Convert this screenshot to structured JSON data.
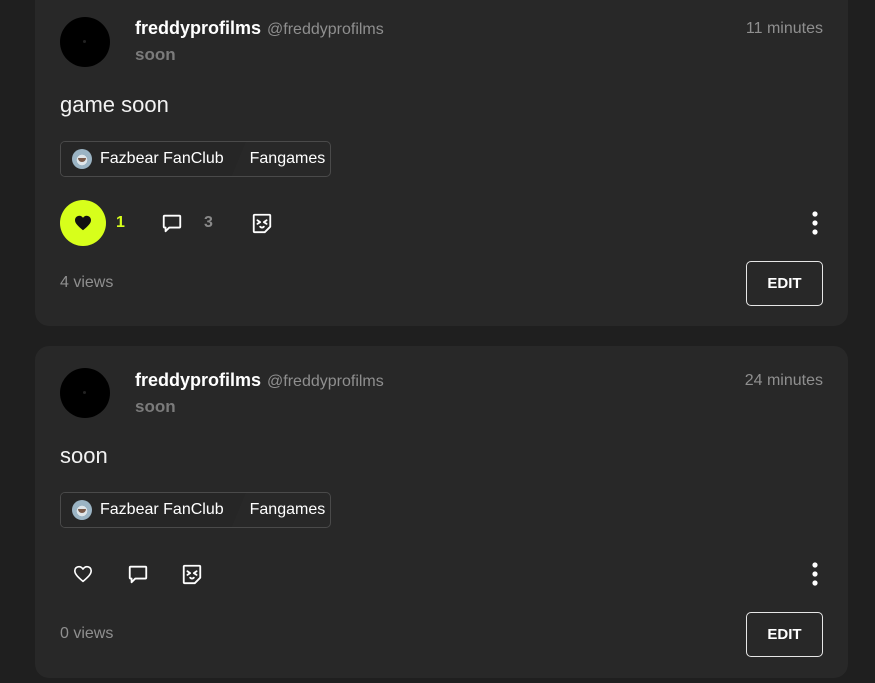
{
  "posts": [
    {
      "author": {
        "display_name": "freddyprofilms",
        "handle": "@freddyprofilms"
      },
      "subtitle": "soon",
      "time": "11 minutes",
      "body": "game soon",
      "community": {
        "name": "Fazbear FanClub",
        "category": "Fangames"
      },
      "likes": "1",
      "liked": true,
      "comments": "3",
      "views": "4 views",
      "edit_label": "EDIT"
    },
    {
      "author": {
        "display_name": "freddyprofilms",
        "handle": "@freddyprofilms"
      },
      "subtitle": "soon",
      "time": "24 minutes",
      "body": "soon",
      "community": {
        "name": "Fazbear FanClub",
        "category": "Fangames"
      },
      "likes": "",
      "liked": false,
      "comments": "",
      "views": "0 views",
      "edit_label": "EDIT"
    }
  ],
  "colors": {
    "accent": "#d7ff1b",
    "card": "#282828",
    "background": "#1f1f1f"
  },
  "icons": [
    "heart-icon",
    "comment-icon",
    "share-icon",
    "more-vertical-icon"
  ]
}
